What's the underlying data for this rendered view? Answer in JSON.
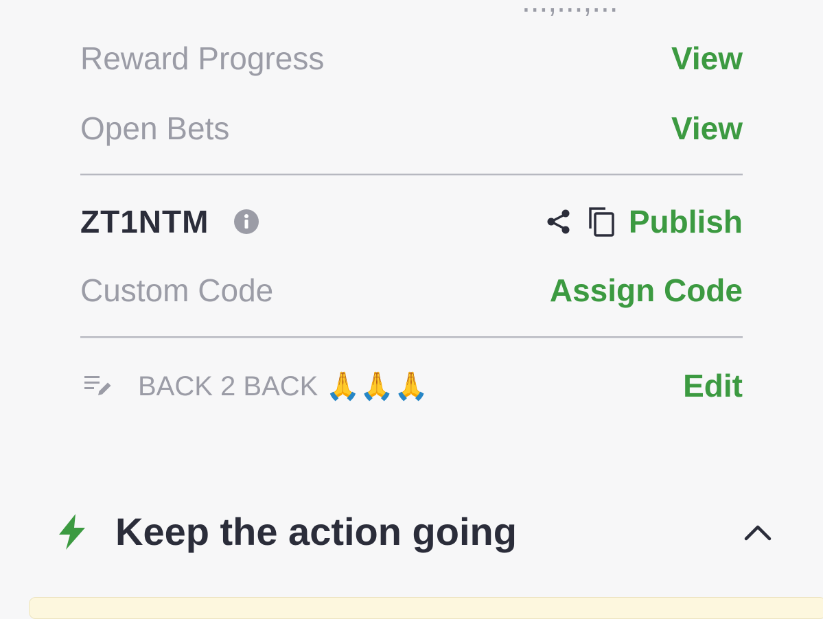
{
  "header_fragment": "...,...,...",
  "rows": {
    "reward_progress": {
      "label": "Reward Progress",
      "action": "View"
    },
    "open_bets": {
      "label": "Open Bets",
      "action": "View"
    },
    "code": {
      "value": "ZT1NTM",
      "action": "Publish"
    },
    "custom_code": {
      "label": "Custom Code",
      "action": "Assign Code"
    },
    "note": {
      "text": "BACK 2 BACK 🙏🙏🙏",
      "action": "Edit"
    }
  },
  "section": {
    "title": "Keep the action going"
  },
  "colors": {
    "accent_green": "#3c9a41",
    "text_dark": "#2b2d3a",
    "text_gray": "#9b9ca6",
    "background": "#f7f7f8"
  },
  "icons": [
    "info-icon",
    "share-icon",
    "copy-icon",
    "edit-note-icon",
    "lightning-bolt-icon",
    "chevron-up-icon"
  ]
}
